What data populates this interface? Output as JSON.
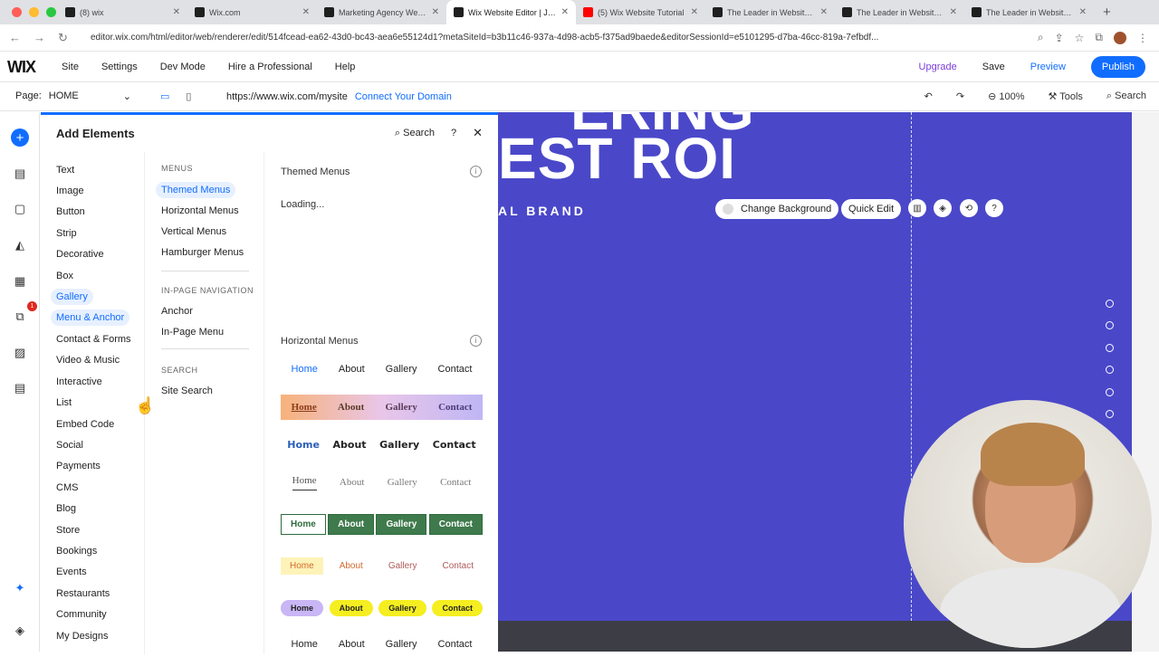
{
  "browser": {
    "tabs": [
      {
        "title": "(8) wix",
        "fav": "#1f1f1f",
        "active": false
      },
      {
        "title": "Wix.com",
        "fav": "#1f1f1f",
        "active": false
      },
      {
        "title": "Marketing Agency Website",
        "fav": "#1f1f1f",
        "active": false
      },
      {
        "title": "Wix Website Editor | Julia",
        "fav": "#1f1f1f",
        "active": true
      },
      {
        "title": "(5) Wix Website Tutorial",
        "fav": "#ff0000",
        "active": false
      },
      {
        "title": "The Leader in Website C",
        "fav": "#1f1f1f",
        "active": false
      },
      {
        "title": "The Leader in Website C",
        "fav": "#1f1f1f",
        "active": false
      },
      {
        "title": "The Leader in Website C",
        "fav": "#1f1f1f",
        "active": false
      }
    ],
    "url": "editor.wix.com/html/editor/web/renderer/edit/514fcead-ea62-43d0-bc43-aea6e55124d1?metaSiteId=b3b11c46-937a-4d98-acb5-f375ad9baede&editorSessionId=e5101295-d7ba-46cc-819a-7efbdf..."
  },
  "topbar": {
    "logo": "WIX",
    "menu": [
      "Site",
      "Settings",
      "Dev Mode",
      "Hire a Professional",
      "Help"
    ],
    "upgrade": "Upgrade",
    "save": "Save",
    "preview": "Preview",
    "publish": "Publish"
  },
  "pagebar": {
    "page_label": "Page:",
    "page_value": "HOME",
    "site_url": "https://www.wix.com/mysite",
    "connect": "Connect Your Domain",
    "zoom": "100%",
    "tools": "Tools",
    "search": "Search"
  },
  "leftbar": {
    "badge": "1"
  },
  "panel": {
    "title": "Add Elements",
    "search": "Search",
    "help": "?",
    "categories": [
      "Text",
      "Image",
      "Button",
      "Strip",
      "Decorative",
      "Box",
      "Gallery",
      "Menu & Anchor",
      "Contact & Forms",
      "Video & Music",
      "Interactive",
      "List",
      "Embed Code",
      "Social",
      "Payments",
      "CMS",
      "Blog",
      "Store",
      "Bookings",
      "Events",
      "Restaurants",
      "Community",
      "My Designs"
    ],
    "selected_category": "Menu & Anchor",
    "sub_sections": {
      "menus_head": "MENUS",
      "menus": [
        "Themed Menus",
        "Horizontal Menus",
        "Vertical Menus",
        "Hamburger Menus"
      ],
      "inpage_head": "IN-PAGE NAVIGATION",
      "inpage": [
        "Anchor",
        "In-Page Menu"
      ],
      "search_head": "SEARCH",
      "search": [
        "Site Search"
      ]
    },
    "themed_title": "Themed Menus",
    "loading": "Loading...",
    "horizontal_title": "Horizontal Menus",
    "menu_labels": [
      "Home",
      "About",
      "Gallery",
      "Contact"
    ]
  },
  "canvas": {
    "hero_top": "ERING",
    "hero_main": "EST ROI",
    "hero_sub": "AL BRAND",
    "change_background": "Change Background",
    "quick_edit": "Quick Edit",
    "bg_color": "#4a48c9"
  }
}
